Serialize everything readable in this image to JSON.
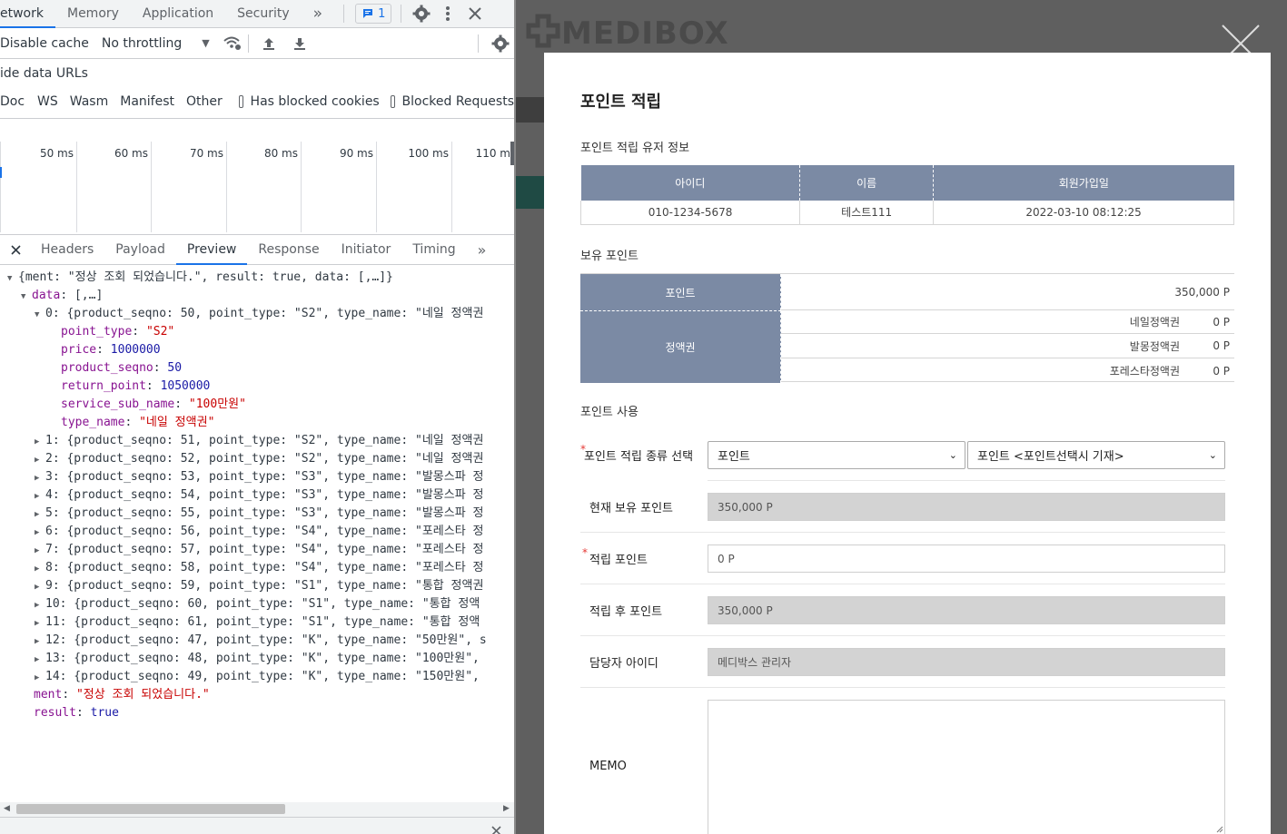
{
  "devtools": {
    "tabs": [
      "etwork",
      "Memory",
      "Application",
      "Security"
    ],
    "more_tabs": "»",
    "issues_badge": "1",
    "toolbar": {
      "disable_cache": "Disable cache",
      "throttling": "No throttling"
    },
    "hide_data_urls": "ide data URLs",
    "filters": [
      "Doc",
      "WS",
      "Wasm",
      "Manifest",
      "Other"
    ],
    "has_blocked_cookies": "Has blocked cookies",
    "blocked_requests": "Blocked Requests",
    "timeline_ticks": [
      "50 ms",
      "60 ms",
      "70 ms",
      "80 ms",
      "90 ms",
      "100 ms",
      "110 m"
    ],
    "panel_tabs": [
      "Headers",
      "Payload",
      "Preview",
      "Response",
      "Initiator",
      "Timing"
    ],
    "preview": {
      "root": "{ment: \"정상 조회 되었습니다.\", result: true, data: [,…]}",
      "data_label": "data",
      "data_summary": "[,…]",
      "item0_summary": "0: {product_seqno: 50, point_type: \"S2\", type_name: \"네일 정액권",
      "item0_fields": [
        {
          "k": "point_type",
          "v": "\"S2\"",
          "t": "s"
        },
        {
          "k": "price",
          "v": "1000000",
          "t": "n"
        },
        {
          "k": "product_seqno",
          "v": "50",
          "t": "n"
        },
        {
          "k": "return_point",
          "v": "1050000",
          "t": "n"
        },
        {
          "k": "service_sub_name",
          "v": "\"100만원\"",
          "t": "s"
        },
        {
          "k": "type_name",
          "v": "\"네일 정액권\"",
          "t": "s"
        }
      ],
      "items": [
        "1: {product_seqno: 51, point_type: \"S2\", type_name: \"네일 정액권",
        "2: {product_seqno: 52, point_type: \"S2\", type_name: \"네일 정액권",
        "3: {product_seqno: 53, point_type: \"S3\", type_name: \"발몽스파 정",
        "4: {product_seqno: 54, point_type: \"S3\", type_name: \"발몽스파 정",
        "5: {product_seqno: 55, point_type: \"S3\", type_name: \"발몽스파 정",
        "6: {product_seqno: 56, point_type: \"S4\", type_name: \"포레스타 정",
        "7: {product_seqno: 57, point_type: \"S4\", type_name: \"포레스타 정",
        "8: {product_seqno: 58, point_type: \"S4\", type_name: \"포레스타 정",
        "9: {product_seqno: 59, point_type: \"S1\", type_name: \"통합 정액권",
        "10: {product_seqno: 60, point_type: \"S1\", type_name: \"통합 정액",
        "11: {product_seqno: 61, point_type: \"S1\", type_name: \"통합 정액",
        "12: {product_seqno: 47, point_type: \"K\", type_name: \"50만원\", s",
        "13: {product_seqno: 48, point_type: \"K\", type_name: \"100만원\",",
        "14: {product_seqno: 49, point_type: \"K\", type_name: \"150만원\","
      ],
      "ment_key": "ment",
      "ment_val": "\"정상 조회 되었습니다.\"",
      "result_key": "result",
      "result_val": "true"
    }
  },
  "background": {
    "logo": "MEDIBOX"
  },
  "modal": {
    "title": "포인트 적립",
    "user_section": "포인트 적립 유저 정보",
    "user_headers": [
      "아이디",
      "이름",
      "회원가입일"
    ],
    "user_row": [
      "010-1234-5678",
      "테스트111",
      "2022-03-10 08:12:25"
    ],
    "owned_section": "보유 포인트",
    "point_label": "포인트",
    "point_value": "350,000 P",
    "voucher_label": "정액권",
    "vouchers": [
      {
        "name": "네일정액권",
        "value": "0 P"
      },
      {
        "name": "발몽정액권",
        "value": "0 P"
      },
      {
        "name": "포레스타정액권",
        "value": "0 P"
      }
    ],
    "use_section": "포인트 사용",
    "fields": {
      "type_label": "포인트 적립 종류 선택",
      "type_select1": "포인트",
      "type_select2": "포인트 <포인트선택시 기재>",
      "current_label": "현재 보유 포인트",
      "current_value": "350,000 P",
      "earn_label": "적립 포인트",
      "earn_value": "0 P",
      "after_label": "적립 후 포인트",
      "after_value": "350,000 P",
      "manager_label": "담당자 아이디",
      "manager_value": "메디박스 관리자",
      "memo_label": "MEMO",
      "memo_value": ""
    }
  }
}
